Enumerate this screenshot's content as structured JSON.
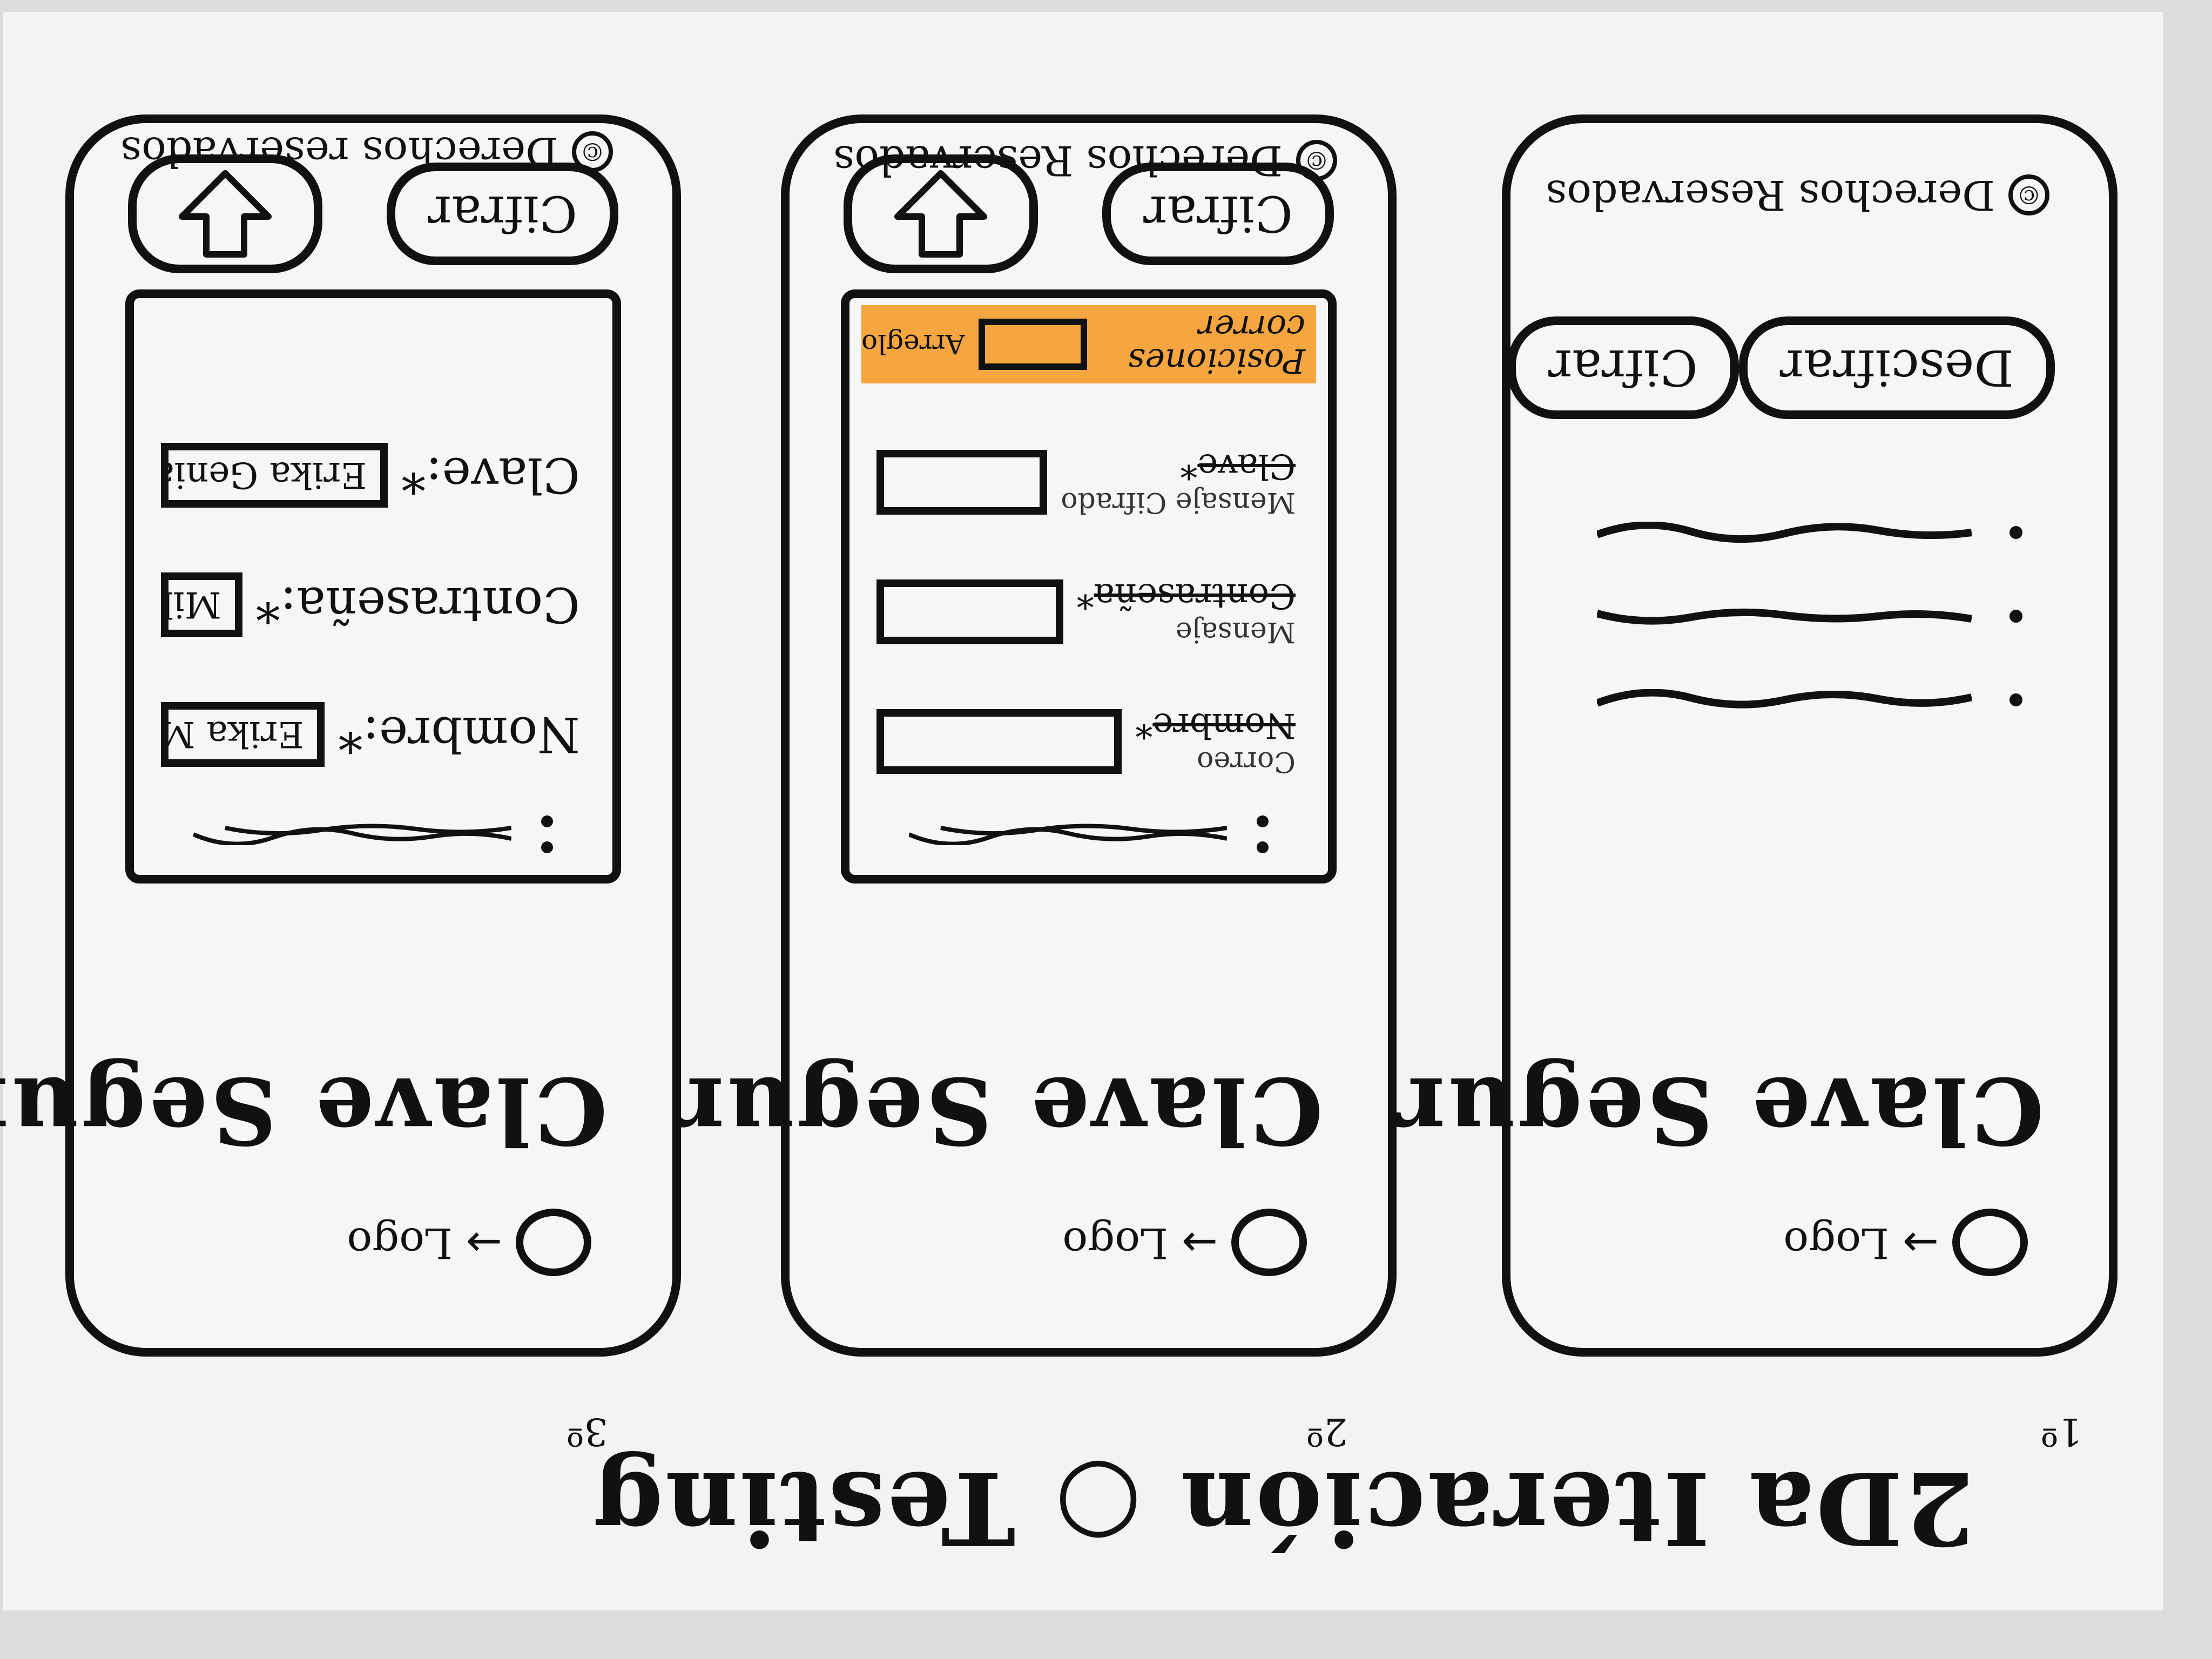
{
  "page_title": "2Da Iteración ○ Testing",
  "step_labels": [
    "1º",
    "2º",
    "3º"
  ],
  "logo_label": "Logo",
  "logo_arrow": "→",
  "app_title": "Clave Segura",
  "screen_1": {
    "buttons": {
      "encrypt": "Cifrar",
      "decrypt": "Descifrar"
    },
    "copyright": "Derechos Reservados",
    "copyright_symbol": "©"
  },
  "screen_2": {
    "fields": [
      {
        "correction": "Correo",
        "struck_label": "Nombre",
        "star": "*"
      },
      {
        "correction": "Mensaje",
        "struck_label": "Contraseña",
        "star": "*"
      },
      {
        "correction": "Mensaje Cifrado",
        "struck_label": "Clave",
        "star": "*"
      }
    ],
    "positions_label": "Posiciones correr",
    "positions_note": "Arreglo",
    "encrypt_button": "Cifrar",
    "copyright": "Derechos Reservados",
    "copyright_symbol": "©"
  },
  "screen_3": {
    "fields": [
      {
        "label": "Nombre:*",
        "value": "Erika Mtz"
      },
      {
        "label": "Contraseña:*",
        "value": "MikEgmal"
      },
      {
        "label": "Clave:*",
        "value": "Erika Genial"
      }
    ],
    "encrypt_button": "Cifrar",
    "copyright": "Derechos reservados",
    "copyright_symbol": "©"
  },
  "colors": {
    "ink": "#111111",
    "highlight": "#f6a640",
    "paper": "#f3f3f1"
  },
  "icons": [
    "logo-circle-icon",
    "arrow-right-icon",
    "menu-kebab-icon",
    "download-arrow-icon",
    "copyright-icon"
  ]
}
